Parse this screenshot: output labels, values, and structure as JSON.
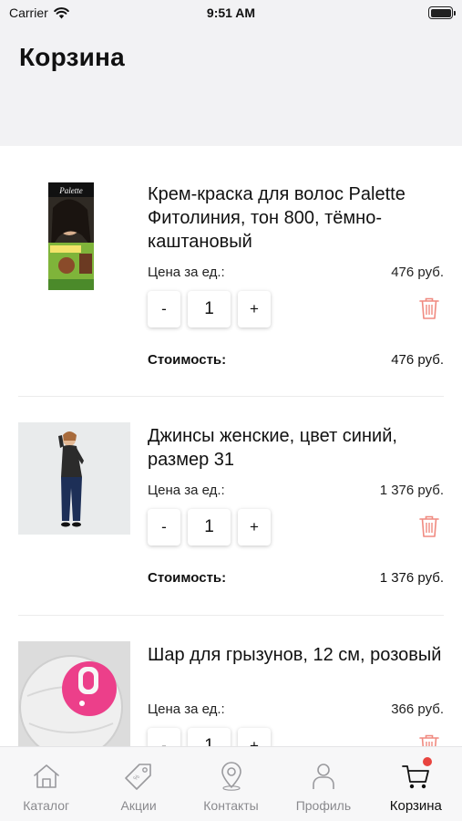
{
  "status_bar": {
    "carrier": "Carrier",
    "time": "9:51 AM"
  },
  "header": {
    "title": "Корзина"
  },
  "labels": {
    "unit_price": "Цена за ед.:",
    "cost": "Стоимость:",
    "minus": "-",
    "plus": "+"
  },
  "items": [
    {
      "title": "Крем-краска для волос Palette Фитолиния, тон 800, тёмно-каштановый",
      "unit_price": "476 руб.",
      "quantity": "1",
      "cost": "476 руб.",
      "image": "hair-dye-box"
    },
    {
      "title": "Джинсы женские, цвет синий, размер 31",
      "unit_price": "1 376 руб.",
      "quantity": "1",
      "cost": "1 376 руб.",
      "image": "woman-in-jeans"
    },
    {
      "title": "Шар для грызунов, 12 см, розовый",
      "unit_price": "366 руб.",
      "quantity": "1",
      "cost": "",
      "image": "rodent-ball"
    }
  ],
  "tabbar": {
    "tabs": [
      {
        "label": "Каталог",
        "icon": "home-icon",
        "active": false
      },
      {
        "label": "Акции",
        "icon": "tag-icon",
        "active": false
      },
      {
        "label": "Контакты",
        "icon": "map-pin-icon",
        "active": false
      },
      {
        "label": "Профиль",
        "icon": "person-icon",
        "active": false
      },
      {
        "label": "Корзина",
        "icon": "cart-icon",
        "active": true,
        "badge": true
      }
    ]
  },
  "colors": {
    "accent_red": "#e8443f",
    "trash_red": "#f08a80",
    "header_bg": "#f2f2f4",
    "inactive_tab": "#8a8a8e"
  }
}
